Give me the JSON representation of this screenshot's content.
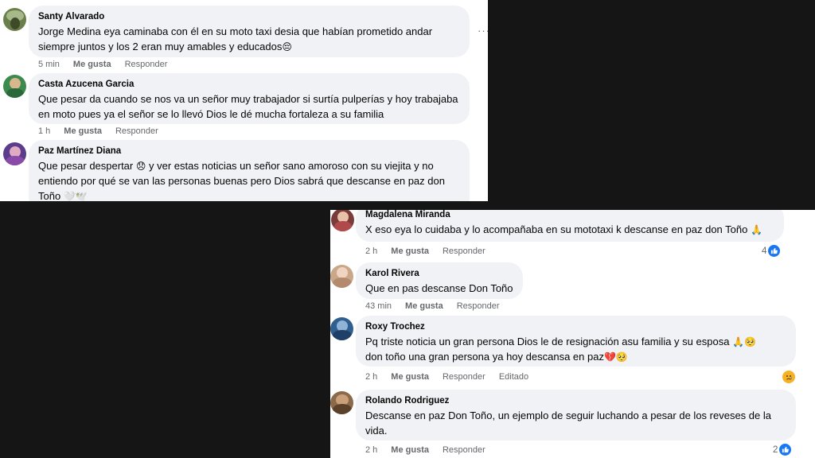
{
  "panel_a": {
    "comments": [
      {
        "author": "Santy Alvarado",
        "text": "Jorge Medina eya caminaba con él en su moto taxi desia que habían prometido andar siempre juntos y los 2 eran muy amables y educados",
        "emoji": "😔",
        "time": "5 min",
        "like": "Me gusta",
        "reply": "Responder"
      },
      {
        "author": "Casta Azucena Garcia",
        "text": "Que pesar da cuando se nos va un señor muy trabajador si surtía pulperías y hoy trabajaba en moto pues ya el señor se lo llevó Dios le dé mucha fortaleza a su familia",
        "time": "1 h",
        "like": "Me gusta",
        "reply": "Responder"
      },
      {
        "author": "Paz Martínez Diana",
        "text_a": "Que pesar despertar",
        "emoji_a": "😞",
        "text_b": "y ver estas noticias un señor sano amoroso con su viejita y no entiendo por qué se van las personas buenas pero Dios sabrá que descanse en paz don Toño",
        "emoji_b": "🤍🕊️"
      }
    ],
    "more_icon": "···"
  },
  "panel_b": {
    "comments": [
      {
        "author": "Magdalena Miranda",
        "text": "X eso eya lo cuidaba y lo acompañaba en su mototaxi k descanse en paz don Toño",
        "emoji": "🙏",
        "time": "2 h",
        "like": "Me gusta",
        "reply": "Responder",
        "reaction_count": "4"
      },
      {
        "author": "Karol Rivera",
        "text": "Que en pas descanse Don Toño",
        "time": "43 min",
        "like": "Me gusta",
        "reply": "Responder"
      },
      {
        "author": "Roxy Trochez",
        "text_a": "Pq triste noticia un gran persona Dios le de resignación asu familia y su esposa",
        "emoji_a": "🙏🥺",
        "text_b": "don toño una gran persona ya hoy descansa en paz",
        "emoji_b": "💔🥺",
        "time": "2 h",
        "like": "Me gusta",
        "reply": "Responder",
        "edited": "Editado"
      },
      {
        "author": "Rolando Rodriguez",
        "text": "Descanse en paz Don Toño, un ejemplo de seguir luchando a pesar de los reveses de la vida.",
        "time": "2 h",
        "like": "Me gusta",
        "reply": "Responder",
        "reaction_count": "2"
      }
    ]
  },
  "colors": {
    "bubble": "#f0f2f5",
    "meta_text": "#65676b",
    "like_blue": "#1877f2",
    "background": "#151515"
  }
}
